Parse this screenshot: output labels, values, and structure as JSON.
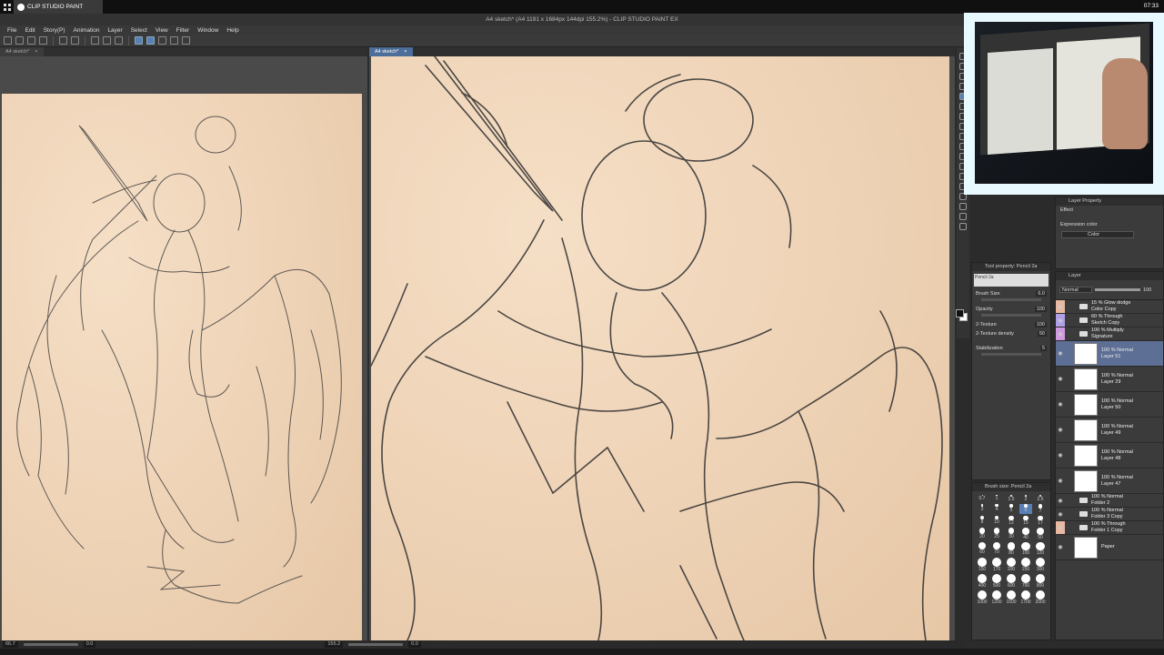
{
  "os": {
    "app_name": "CLIP STUDIO PAINT",
    "clock": "07:33"
  },
  "window_title": "A4 sketch* (A4 1191 x 1684px 144dpi 155.2%) - CLIP STUDIO PAINT EX",
  "menu": [
    "File",
    "Edit",
    "Story(P)",
    "Animation",
    "Layer",
    "Select",
    "View",
    "Filter",
    "Window",
    "Help"
  ],
  "tabs": {
    "left": "A4 sketch*",
    "right": "A4 sketch*"
  },
  "status": {
    "left_zoom": "66.7",
    "right_zoom": "155.2",
    "angle_left": "0.0",
    "angle_right": "0.0"
  },
  "layer_property": {
    "title": "Layer Property",
    "effect_label": "Effect",
    "expression_label": "Expression color",
    "expression_value": "Color"
  },
  "tool_property": {
    "title": "Tool property: Pencil 2a",
    "brush_name": "Pencil 2a",
    "rows": [
      {
        "label": "Brush Size",
        "value": "6.0"
      },
      {
        "label": "Opacity",
        "value": "100"
      },
      {
        "label": "2-Texture",
        "value": "100"
      },
      {
        "label": "2-Texture density",
        "value": "50"
      },
      {
        "label": "Stabilization",
        "value": "5"
      }
    ]
  },
  "brush_size": {
    "title": "Brush size: Pencil 2a",
    "sizes": [
      "0.7",
      "1",
      "1.5",
      "2",
      "2.5",
      "3",
      "4",
      "5",
      "6",
      "7",
      "8",
      "10",
      "12",
      "15",
      "17",
      "20",
      "25",
      "30",
      "40",
      "50",
      "60",
      "70",
      "80",
      "100",
      "120",
      "150",
      "170",
      "200",
      "250",
      "300",
      "400",
      "500",
      "600",
      "700",
      "800",
      "1000",
      "1200",
      "1500",
      "1700",
      "2000"
    ],
    "selected": "6"
  },
  "layer_panel": {
    "title": "Layer",
    "blend_mode": "Normal",
    "opacity": "100",
    "layers": [
      {
        "mode": "15 % Glow dodge",
        "name": "Color Copy",
        "type": "folder",
        "tag": "tag"
      },
      {
        "mode": "60 % Through",
        "name": "Sketch Copy",
        "type": "folder",
        "tag": "tag2"
      },
      {
        "mode": "100 % Multiply",
        "name": "Signature",
        "type": "folder",
        "tag": "tag3"
      },
      {
        "mode": "100 % Normal",
        "name": "Layer 51",
        "type": "layer",
        "selected": true
      },
      {
        "mode": "100 % Normal",
        "name": "Layer 29",
        "type": "layer"
      },
      {
        "mode": "100 % Normal",
        "name": "Layer 50",
        "type": "layer"
      },
      {
        "mode": "100 % Normal",
        "name": "Layer 49",
        "type": "layer"
      },
      {
        "mode": "100 % Normal",
        "name": "Layer 48",
        "type": "layer"
      },
      {
        "mode": "100 % Normal",
        "name": "Layer 47",
        "type": "layer"
      },
      {
        "mode": "100 % Normal",
        "name": "Folder 2",
        "type": "folder"
      },
      {
        "mode": "100 % Normal",
        "name": "Folder 3 Copy",
        "type": "folder"
      },
      {
        "mode": "100 % Through",
        "name": "Folder 1 Copy",
        "type": "folder",
        "tag": "tag"
      },
      {
        "mode": "",
        "name": "Paper",
        "type": "paper"
      }
    ]
  }
}
